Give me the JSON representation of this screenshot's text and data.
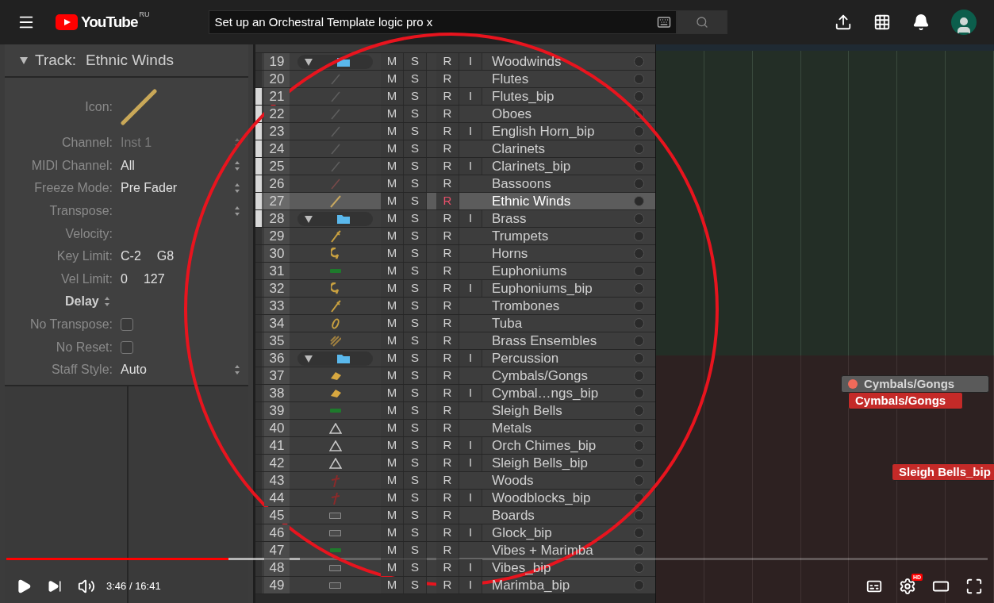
{
  "topbar": {
    "logo_text": "YouTube",
    "region": "RU",
    "search": {
      "value": "Set up an Orchestral Template logic pro x"
    }
  },
  "inspector": {
    "title_label": "Track:",
    "title_value": "Ethnic Winds",
    "expanded": true,
    "fields": [
      {
        "kind": "icon",
        "label": "Icon:"
      },
      {
        "kind": "popup",
        "label": "Channel:",
        "value": "Inst 1",
        "disabled": true
      },
      {
        "kind": "popup",
        "label": "MIDI Channel:",
        "value": "All",
        "disabled": false
      },
      {
        "kind": "popup",
        "label": "Freeze Mode:",
        "value": "Pre Fader",
        "disabled": false
      },
      {
        "kind": "popup",
        "label": "Transpose:"
      },
      {
        "kind": "text",
        "label": "Velocity:"
      },
      {
        "kind": "pair",
        "label": "Key Limit:",
        "values": [
          "C-2",
          "G8"
        ]
      },
      {
        "kind": "pair",
        "label": "Vel Limit:",
        "values": [
          "0",
          "127"
        ]
      },
      {
        "kind": "section",
        "label": "Delay"
      },
      {
        "kind": "checkbox",
        "label": "No Transpose:",
        "checked": false
      },
      {
        "kind": "checkbox",
        "label": "No Reset:",
        "checked": false
      },
      {
        "kind": "popup",
        "label": "Staff Style:",
        "value": "Auto",
        "disabled": false
      }
    ]
  },
  "tracks": [
    {
      "number": "19",
      "name": "Woodwinds",
      "kind": "folder",
      "expanded": true,
      "buttons": [
        "M",
        "S",
        "R",
        "I"
      ],
      "armed": false,
      "selected": false,
      "marked": false
    },
    {
      "number": "20",
      "name": "Flutes",
      "kind": "flute",
      "buttons": [
        "M",
        "S",
        "R"
      ],
      "armed": false,
      "selected": false,
      "marked": false
    },
    {
      "number": "21",
      "name": "Flutes_bip",
      "kind": "flute",
      "buttons": [
        "M",
        "S",
        "R",
        "I"
      ],
      "armed": false,
      "selected": false,
      "marked": true
    },
    {
      "number": "22",
      "name": "Oboes",
      "kind": "flute",
      "buttons": [
        "M",
        "S",
        "R"
      ],
      "armed": false,
      "selected": false,
      "marked": true
    },
    {
      "number": "23",
      "name": "English Horn_bip",
      "kind": "flute",
      "buttons": [
        "M",
        "S",
        "R",
        "I"
      ],
      "armed": false,
      "selected": false,
      "marked": true
    },
    {
      "number": "24",
      "name": "Clarinets",
      "kind": "flute",
      "buttons": [
        "M",
        "S",
        "R"
      ],
      "armed": false,
      "selected": false,
      "marked": true
    },
    {
      "number": "25",
      "name": "Clarinets_bip",
      "kind": "flute",
      "buttons": [
        "M",
        "S",
        "R",
        "I"
      ],
      "armed": false,
      "selected": false,
      "marked": true
    },
    {
      "number": "26",
      "name": "Bassoons",
      "kind": "bassoon",
      "buttons": [
        "M",
        "S",
        "R"
      ],
      "armed": false,
      "selected": false,
      "marked": true
    },
    {
      "number": "27",
      "name": "Ethnic Winds",
      "kind": "recorder",
      "buttons": [
        "M",
        "S",
        "R"
      ],
      "armed": true,
      "selected": true,
      "marked": true
    },
    {
      "number": "28",
      "name": "Brass",
      "kind": "folder",
      "expanded": true,
      "buttons": [
        "M",
        "S",
        "R",
        "I"
      ],
      "armed": false,
      "selected": false,
      "marked": true
    },
    {
      "number": "29",
      "name": "Trumpets",
      "kind": "trumpet",
      "buttons": [
        "M",
        "S",
        "R"
      ],
      "armed": false,
      "selected": false,
      "marked": false
    },
    {
      "number": "30",
      "name": "Horns",
      "kind": "horn",
      "buttons": [
        "M",
        "S",
        "R"
      ],
      "armed": false,
      "selected": false,
      "marked": false
    },
    {
      "number": "31",
      "name": "Euphoniums",
      "kind": "block",
      "buttons": [
        "M",
        "S",
        "R"
      ],
      "armed": false,
      "selected": false,
      "marked": false
    },
    {
      "number": "32",
      "name": "Euphoniums_bip",
      "kind": "horn",
      "buttons": [
        "M",
        "S",
        "R",
        "I"
      ],
      "armed": false,
      "selected": false,
      "marked": false
    },
    {
      "number": "33",
      "name": "Trombones",
      "kind": "trumpet",
      "buttons": [
        "M",
        "S",
        "R"
      ],
      "armed": false,
      "selected": false,
      "marked": false
    },
    {
      "number": "34",
      "name": "Tuba",
      "kind": "tuba",
      "buttons": [
        "M",
        "S",
        "R"
      ],
      "armed": false,
      "selected": false,
      "marked": false
    },
    {
      "number": "35",
      "name": "Brass Ensembles",
      "kind": "ensemble",
      "buttons": [
        "M",
        "S",
        "R"
      ],
      "armed": false,
      "selected": false,
      "marked": false
    },
    {
      "number": "36",
      "name": "Percussion",
      "kind": "folder",
      "expanded": true,
      "buttons": [
        "M",
        "S",
        "R",
        "I"
      ],
      "armed": false,
      "selected": false,
      "marked": false
    },
    {
      "number": "37",
      "name": "Cymbals/Gongs",
      "kind": "cymbal",
      "buttons": [
        "M",
        "S",
        "R"
      ],
      "armed": false,
      "selected": false,
      "marked": false
    },
    {
      "number": "38",
      "name": "Cymbal…ngs_bip",
      "kind": "cymbal",
      "buttons": [
        "M",
        "S",
        "R",
        "I"
      ],
      "armed": false,
      "selected": false,
      "marked": false
    },
    {
      "number": "39",
      "name": "Sleigh Bells",
      "kind": "block",
      "buttons": [
        "M",
        "S",
        "R"
      ],
      "armed": false,
      "selected": false,
      "marked": false
    },
    {
      "number": "40",
      "name": "Metals",
      "kind": "triangle",
      "buttons": [
        "M",
        "S",
        "R"
      ],
      "armed": false,
      "selected": false,
      "marked": false
    },
    {
      "number": "41",
      "name": "Orch Chimes_bip",
      "kind": "triangle",
      "buttons": [
        "M",
        "S",
        "R",
        "I"
      ],
      "armed": false,
      "selected": false,
      "marked": false
    },
    {
      "number": "42",
      "name": "Sleigh Bells_bip",
      "kind": "triangle",
      "buttons": [
        "M",
        "S",
        "R",
        "I"
      ],
      "armed": false,
      "selected": false,
      "marked": false
    },
    {
      "number": "43",
      "name": "Woods",
      "kind": "stick",
      "buttons": [
        "M",
        "S",
        "R"
      ],
      "armed": false,
      "selected": false,
      "marked": false
    },
    {
      "number": "44",
      "name": "Woodblocks_bip",
      "kind": "stick",
      "buttons": [
        "M",
        "S",
        "R",
        "I"
      ],
      "armed": false,
      "selected": false,
      "marked": false
    },
    {
      "number": "45",
      "name": "Boards",
      "kind": "board",
      "buttons": [
        "M",
        "S",
        "R"
      ],
      "armed": false,
      "selected": false,
      "marked": false
    },
    {
      "number": "46",
      "name": "Glock_bip",
      "kind": "board",
      "buttons": [
        "M",
        "S",
        "R",
        "I"
      ],
      "armed": false,
      "selected": false,
      "marked": false
    },
    {
      "number": "47",
      "name": "Vibes + Marimba",
      "kind": "block",
      "buttons": [
        "M",
        "S",
        "R"
      ],
      "armed": false,
      "selected": false,
      "marked": false
    },
    {
      "number": "48",
      "name": "Vibes_bip",
      "kind": "board",
      "buttons": [
        "M",
        "S",
        "R",
        "I"
      ],
      "armed": false,
      "selected": false,
      "marked": false
    },
    {
      "number": "49",
      "name": "Marimba_bip",
      "kind": "board",
      "buttons": [
        "M",
        "S",
        "R",
        "I"
      ],
      "armed": false,
      "selected": false,
      "marked": false
    }
  ],
  "regions": [
    {
      "kind": "header",
      "name": "Cymbals/Gongs"
    },
    {
      "kind": "region",
      "name": "Cymbals/Gongs"
    },
    {
      "kind": "region",
      "name": "Sleigh Bells_bip"
    }
  ],
  "player": {
    "progress": {
      "level": 0.226
    },
    "buffer": {
      "level": 0.299
    },
    "time": "3:46 / 16:41",
    "quality_badge": "HD"
  }
}
